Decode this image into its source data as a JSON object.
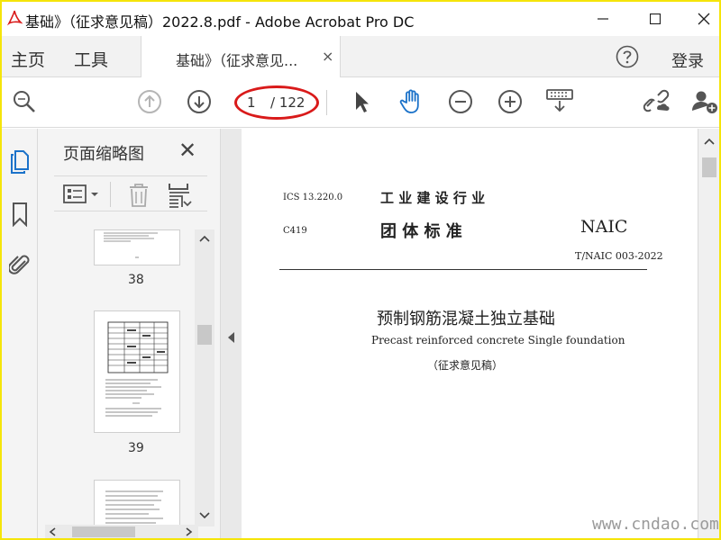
{
  "window": {
    "title": "基础》（征求意见稿）2022.8.pdf - Adobe Acrobat Pro DC"
  },
  "tabs": {
    "home": "主页",
    "tools": "工具",
    "document": "基础》（征求意见...",
    "close_glyph": "×",
    "login": "登录"
  },
  "toolbar": {
    "page_current": "1",
    "page_total": "/ 122",
    "icons": [
      "zoom-search-icon",
      "page-up-icon",
      "page-down-icon",
      "select-cursor-icon",
      "hand-tool-icon",
      "zoom-out-icon",
      "zoom-in-icon",
      "fit-page-icon",
      "share-link-icon",
      "add-user-icon"
    ]
  },
  "panel": {
    "title": "页面缩略图",
    "close_glyph": "✕",
    "thumbnails": [
      {
        "label": "38"
      },
      {
        "label": "39"
      }
    ]
  },
  "document": {
    "ics": "ICS 13.220.0",
    "header_cn1": "工 业 建 设 行 业",
    "code": "C419",
    "header_cn2": "团  体  标  准",
    "naic": "NAIC",
    "std_no": "T/NAIC 003-2022",
    "title_cn": "预制钢筋混凝土独立基础",
    "title_en": "Precast reinforced concrete Single foundation",
    "status": "（征求意见稿）"
  },
  "watermark": "www.cndao.com",
  "colors": {
    "highlight_ellipse": "#d91a1a",
    "hand_tool_active": "#1b72c9",
    "frame_border": "#f5e50a"
  }
}
